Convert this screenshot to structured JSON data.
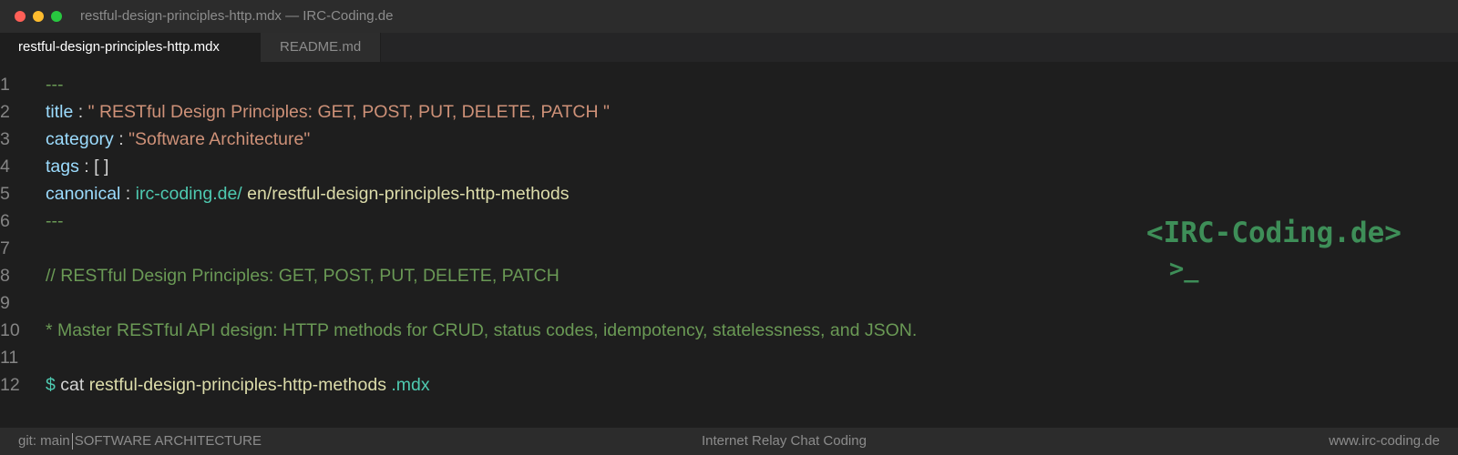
{
  "window": {
    "title": "restful-design-principles-http.mdx — IRC-Coding.de"
  },
  "tabs": [
    {
      "label": "restful-design-principles-http.mdx",
      "active": true
    },
    {
      "label": "README.md",
      "active": false
    }
  ],
  "editor": {
    "line_numbers": [
      "1",
      "2",
      "3",
      "4",
      "5",
      "6",
      "7",
      "8",
      "9",
      "10",
      "11",
      "12"
    ],
    "line1": {
      "text": "---"
    },
    "line2": {
      "key": "title",
      "sep": " : ",
      "value": "\" RESTful Design Principles: GET, POST, PUT, DELETE, PATCH \""
    },
    "line3": {
      "key": "category",
      "sep": " : ",
      "value": "\"Software Architecture\""
    },
    "line4": {
      "key": "tags",
      "sep": " : ",
      "value": "[ ]"
    },
    "line5": {
      "key": "canonical",
      "sep": " : ",
      "domain": "irc-coding.de/",
      "path": " en/restful-design-principles-http-methods"
    },
    "line6": {
      "text": "---"
    },
    "line8": {
      "text": "// RESTful Design Principles: GET, POST, PUT, DELETE, PATCH"
    },
    "line10": {
      "text": "* Master RESTful API design: HTTP methods for CRUD, status codes, idempotency, statelessness, and JSON."
    },
    "line12": {
      "prompt": "$",
      "command": " cat",
      "file": " restful-design-principles-http-methods",
      "ext": " .mdx"
    }
  },
  "logo": {
    "text": "<IRC-Coding.de>",
    "prompt": ">_"
  },
  "statusbar": {
    "branch": "git: main",
    "category": "SOFTWARE ARCHITECTURE",
    "center": "Internet Relay Chat Coding",
    "right": "www.irc-coding.de"
  },
  "colors": {
    "background": "#1e1e1e",
    "key": "#9cdcfe",
    "string": "#ce9178",
    "comment": "#6a9955",
    "accent_teal": "#4ec9b0",
    "logo_green": "#3e8e58"
  }
}
